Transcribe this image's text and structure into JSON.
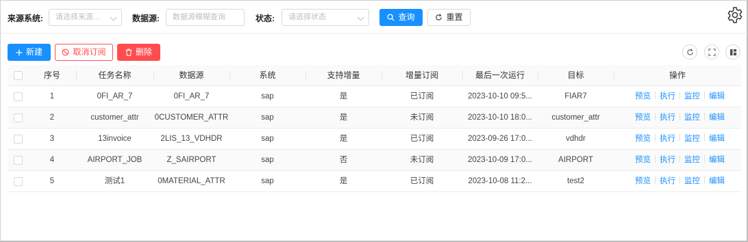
{
  "filters": {
    "source_label": "来源系统:",
    "source_placeholder": "请选择来源...",
    "datasource_label": "数据源:",
    "datasource_placeholder": "数据源模糊查询",
    "status_label": "状态:",
    "status_placeholder": "请选择状态",
    "query_label": "查询",
    "reset_label": "重置"
  },
  "toolbar": {
    "new_label": "新建",
    "unsubscribe_label": "取消订阅",
    "delete_label": "删除"
  },
  "colors": {
    "primary": "#1890ff",
    "danger": "#ff4d4f"
  },
  "icons": [
    "search-icon",
    "reload-icon",
    "gear-icon",
    "plus-icon",
    "stop-icon",
    "trash-icon",
    "refresh-icon",
    "fullscreen-icon",
    "column-settings-icon",
    "chevron-down-icon"
  ],
  "table": {
    "columns": [
      "序号",
      "任务名称",
      "数据源",
      "系统",
      "支持增量",
      "增量订阅",
      "最后一次运行",
      "目标",
      "操作"
    ],
    "rows": [
      [
        "1",
        "0FI_AR_7",
        "0FI_AR_7",
        "sap",
        "是",
        "已订阅",
        "2023-10-10 09:5...",
        "FIAR7"
      ],
      [
        "2",
        "customer_attr",
        "0CUSTOMER_ATTR",
        "sap",
        "是",
        "未订阅",
        "2023-10-10 18:0...",
        "customer_attr"
      ],
      [
        "3",
        "13invoice",
        "2LIS_13_VDHDR",
        "sap",
        "是",
        "已订阅",
        "2023-09-26 17:0...",
        "vdhdr"
      ],
      [
        "4",
        "AIRPORT_JOB",
        "Z_SAIRPORT",
        "sap",
        "否",
        "未订阅",
        "2023-10-09 17:0...",
        "AIRPORT"
      ],
      [
        "5",
        "测试1",
        "0MATERIAL_ATTR",
        "sap",
        "是",
        "已订阅",
        "2023-10-08 11:2...",
        "test2"
      ]
    ],
    "actions": [
      "预览",
      "执行",
      "监控",
      "编辑"
    ]
  }
}
